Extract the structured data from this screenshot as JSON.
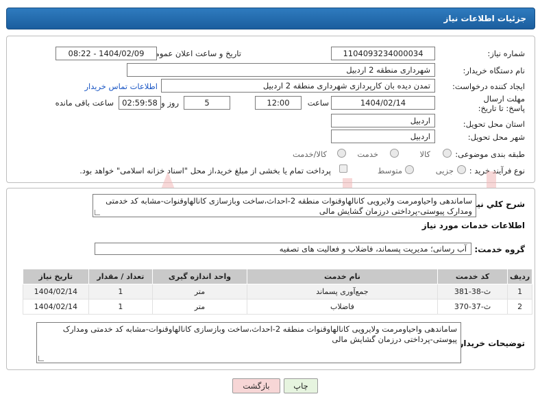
{
  "header": {
    "title": "جزئیات اطلاعات نیاز"
  },
  "labels": {
    "need_number": "شماره نیاز:",
    "announce_datetime": "تاریخ و ساعت اعلان عمومی:",
    "buyer_org": "نام دستگاه خریدار:",
    "requester": "ایجاد کننده درخواست:",
    "deadline": "مهلت ارسال پاسخ: تا تاریخ:",
    "time": "ساعت",
    "day_and": "روز و",
    "remaining": "ساعت باقی مانده",
    "province": "استان محل تحویل:",
    "city": "شهر محل تحویل:",
    "category": "طبقه بندی موضوعی:",
    "purchase_type": "نوع فرآیند خرید :",
    "need_desc": "شرح کلي نیاز:",
    "services_info": "اطلاعات خدمات مورد نیاز",
    "service_group": "گروه خدمت:",
    "buyer_notes": "توضیحات خریدار:"
  },
  "values": {
    "need_number": "1104093234000034",
    "announce_datetime": "1404/02/09 - 08:22",
    "buyer_org": "شهرداری منطقه 2 اردبیل",
    "requester": "تمدن دیده بان کارپردازی شهرداری منطقه 2 اردبیل",
    "contact_link": "اطلاعات تماس خریدار",
    "deadline_date": "1404/02/14",
    "deadline_time": "12:00",
    "days": "5",
    "remaining_time": "02:59:58",
    "province": "اردبیل",
    "city": "اردبیل",
    "need_desc": "ساماندهی واحیاومرمت ولایرویی کانالهاوقنوات منطقه 2-احداث،ساخت وبازسازی کانالهاوقنوات-مشابه کد خدمتی ومدارک پیوستی-پرداختی درزمان گشایش مالی",
    "service_group": "آب رسانی؛ مدیریت پسماند، فاضلاب و فعالیت های تصفیه",
    "buyer_notes": "ساماندهی واحیاومرمت ولایرویی کانالهاوقنوات منطقه 2-احداث،ساخت وبازسازی کانالهاوقنوات-مشابه کد خدمتی ومدارک پیوستی-پرداختی درزمان گشایش مالی"
  },
  "category_options": [
    "کالا",
    "خدمت",
    "کالا/خدمت"
  ],
  "purchase_options": [
    "جزیی",
    "متوسط"
  ],
  "payment_note": "پرداخت تمام یا بخشی از مبلغ خرید،از محل \"اسناد خزانه اسلامی\" خواهد بود.",
  "table": {
    "headers": [
      "ردیف",
      "کد خدمت",
      "نام خدمت",
      "واحد اندازه گیری",
      "تعداد / مقدار",
      "تاریخ نیاز"
    ],
    "rows": [
      [
        "1",
        "ث-38-381",
        "جمع‌آوری پسماند",
        "متر",
        "1",
        "1404/02/14"
      ],
      [
        "2",
        "ث-37-370",
        "فاضلاب",
        "متر",
        "1",
        "1404/02/14"
      ]
    ]
  },
  "buttons": {
    "print": "چاپ",
    "back": "بازگشت"
  },
  "colors": {
    "header": "#1b5e9e",
    "link": "#1a56c4",
    "back_button": "#f7d6d6",
    "print_button": "#e6f4df"
  }
}
